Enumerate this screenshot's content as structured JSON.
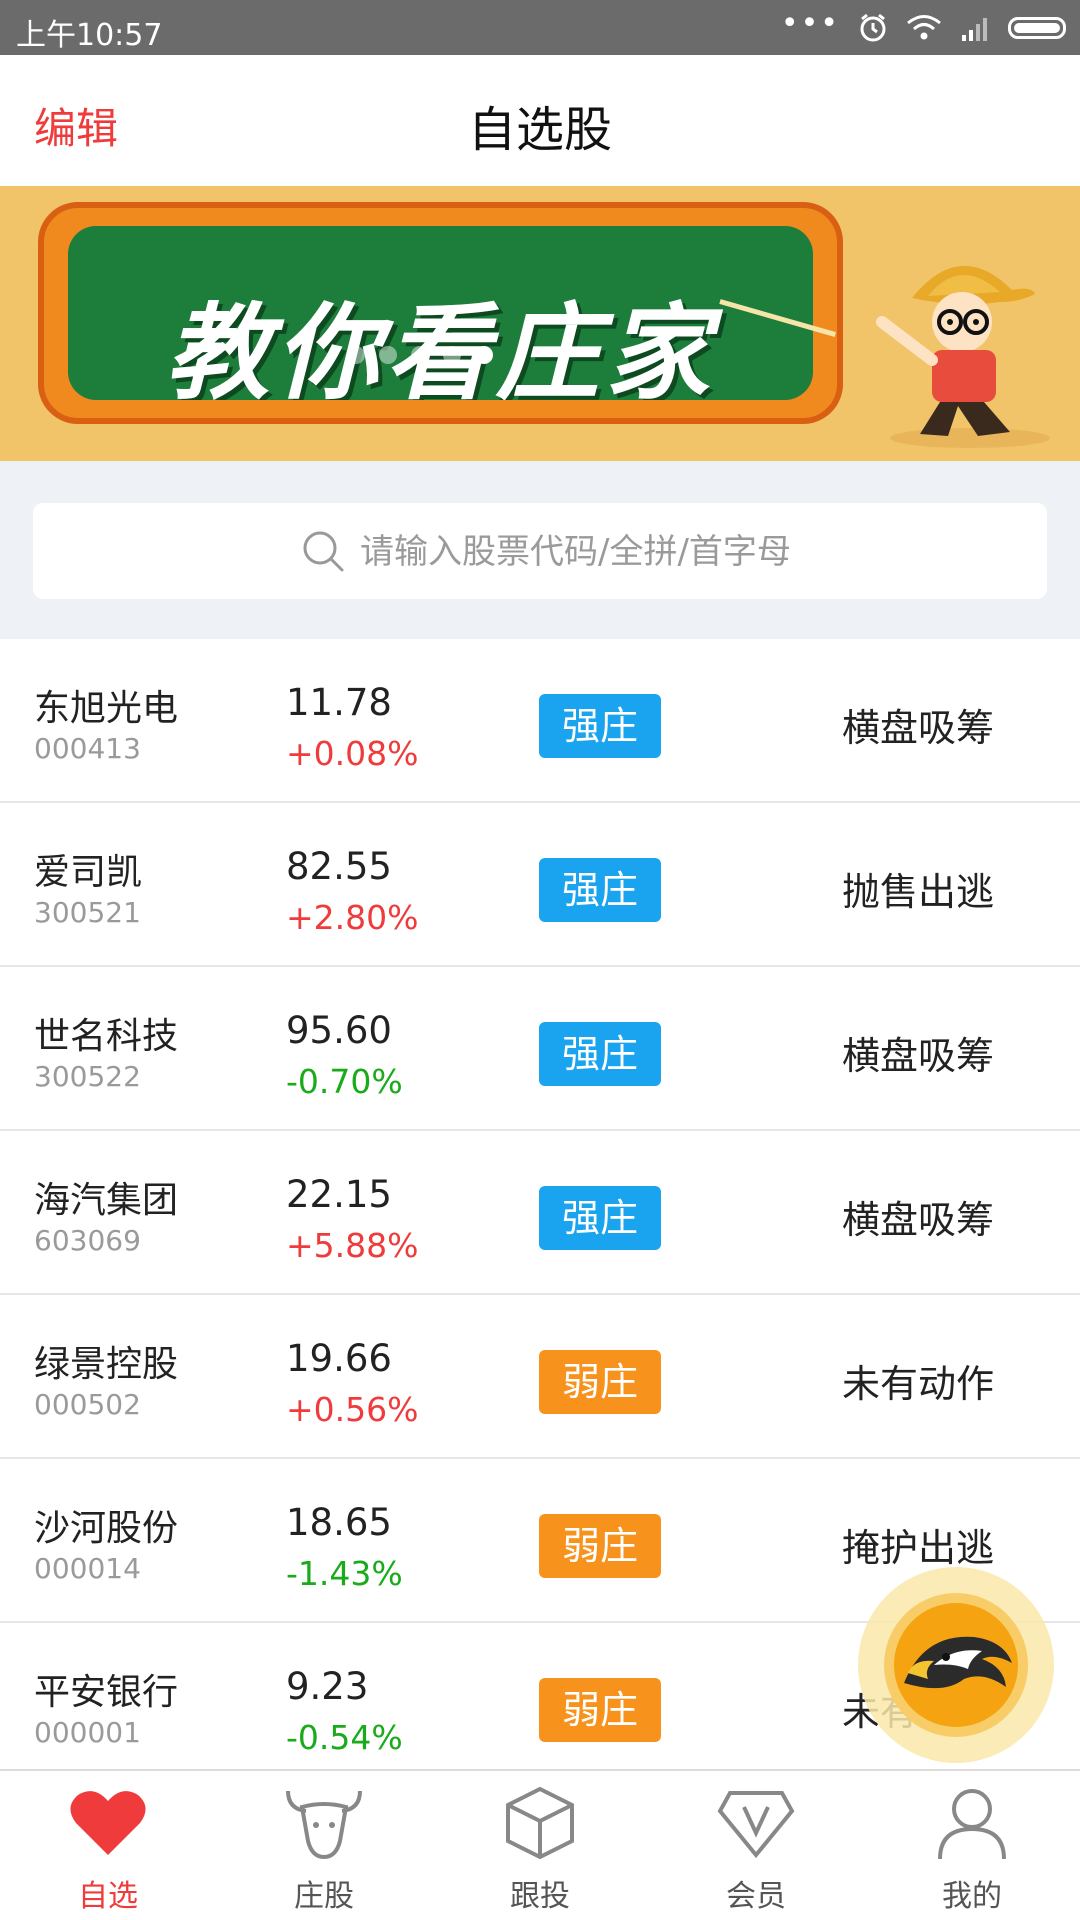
{
  "status_bar": {
    "time": "上午10:57",
    "dots": "•••"
  },
  "header": {
    "edit_label": "编辑",
    "title": "自选股"
  },
  "banner": {
    "headline": "教你看庄家",
    "slide_count": 5,
    "active_slide": 5
  },
  "search": {
    "placeholder": "请输入股票代码/全拼/首字母",
    "value": ""
  },
  "stocks": [
    {
      "name": "东旭光电",
      "code": "000413",
      "price": "11.78",
      "change": "+0.08%",
      "direction": "up",
      "tag": "强庄",
      "tag_type": "strong",
      "action": "横盘吸筹"
    },
    {
      "name": "爱司凯",
      "code": "300521",
      "price": "82.55",
      "change": "+2.80%",
      "direction": "up",
      "tag": "强庄",
      "tag_type": "strong",
      "action": "抛售出逃"
    },
    {
      "name": "世名科技",
      "code": "300522",
      "price": "95.60",
      "change": "-0.70%",
      "direction": "down",
      "tag": "强庄",
      "tag_type": "strong",
      "action": "横盘吸筹"
    },
    {
      "name": "海汽集团",
      "code": "603069",
      "price": "22.15",
      "change": "+5.88%",
      "direction": "up",
      "tag": "强庄",
      "tag_type": "strong",
      "action": "横盘吸筹"
    },
    {
      "name": "绿景控股",
      "code": "000502",
      "price": "19.66",
      "change": "+0.56%",
      "direction": "up",
      "tag": "弱庄",
      "tag_type": "weak",
      "action": "未有动作"
    },
    {
      "name": "沙河股份",
      "code": "000014",
      "price": "18.65",
      "change": "-1.43%",
      "direction": "down",
      "tag": "弱庄",
      "tag_type": "weak",
      "action": "掩护出逃"
    },
    {
      "name": "平安银行",
      "code": "000001",
      "price": "9.23",
      "change": "-0.54%",
      "direction": "down",
      "tag": "弱庄",
      "tag_type": "weak",
      "action": "未有动作"
    }
  ],
  "bottom_nav": [
    {
      "label": "自选",
      "icon": "heart-icon",
      "active": true
    },
    {
      "label": "庄股",
      "icon": "bull-icon",
      "active": false
    },
    {
      "label": "跟投",
      "icon": "cube-icon",
      "active": false
    },
    {
      "label": "会员",
      "icon": "vip-diamond-icon",
      "active": false
    },
    {
      "label": "我的",
      "icon": "user-icon",
      "active": false
    }
  ],
  "colors": {
    "accent_red": "#ef3b3b",
    "strong_tag": "#1aa3ee",
    "weak_tag": "#f7931d",
    "down_green": "#1aaa1a"
  }
}
